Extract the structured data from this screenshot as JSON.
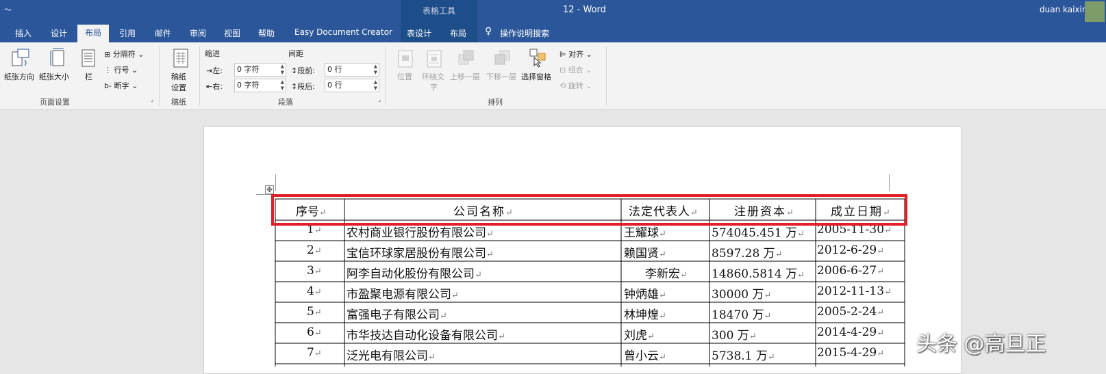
{
  "titlebar": {
    "quick_access": "〜",
    "context_label": "表格工具",
    "doc_title": "12  -  Word",
    "user": "duan kaixin"
  },
  "tabs": [
    "插入",
    "设计",
    "布局",
    "引用",
    "邮件",
    "审阅",
    "视图",
    "帮助",
    "Easy Document Creator",
    "表设计",
    "布局",
    "操作说明搜索"
  ],
  "active_tab": "布局",
  "ribbon": {
    "page_setup": {
      "orientation": "纸张方向",
      "size": "纸张大小",
      "columns": "栏",
      "breaks": "分隔符",
      "line_numbers": "行号",
      "hyphenation": "断字",
      "group": "页面设置"
    },
    "manuscript": {
      "settings_line1": "稿纸",
      "settings_line2": "设置",
      "group": "稿纸"
    },
    "paragraph": {
      "indent": "缩进",
      "spacing": "间距",
      "left_label": "左:",
      "left_value": "0 字符",
      "right_label": "右:",
      "right_value": "0 字符",
      "before_label": "段前:",
      "before_value": "0 行",
      "after_label": "段后:",
      "after_value": "0 行",
      "group": "段落"
    },
    "arrange": {
      "position": "位置",
      "wrap_line1": "环绕文",
      "wrap_line2": "字",
      "bring_forward": "上移一层",
      "send_backward": "下移一层",
      "selection_pane": "选择窗格",
      "align": "对齐",
      "group_btn": "组合",
      "rotate": "旋转",
      "group": "排列"
    }
  },
  "table": {
    "headers": [
      "序号",
      "公司名称",
      "法定代表人",
      "注册资本",
      "成立日期"
    ],
    "rows": [
      [
        "1",
        "农村商业银行股份有限公司",
        "王耀球",
        "574045.451 万",
        "2005-11-30"
      ],
      [
        "2",
        "宝信环球家居股份有限公司",
        "赖国贤",
        "8597.28 万",
        "2012-6-29"
      ],
      [
        "3",
        "阿李自动化股份有限公司",
        "李新宏",
        "14860.5814 万",
        "2006-6-27"
      ],
      [
        "4",
        "市盈聚电源有限公司",
        "钟炳雄",
        "30000 万",
        "2012-11-13"
      ],
      [
        "5",
        "富强电子有限公司",
        "林坤煌",
        "18470 万",
        "2005-2-24"
      ],
      [
        "6",
        "市华技达自动化设备有限公司",
        "刘虎",
        "300 万",
        "2014-4-29"
      ],
      [
        "7",
        "泛光电有限公司",
        "曾小云",
        "5738.1 万",
        "2015-4-29"
      ]
    ],
    "cell_mark": "↵"
  },
  "watermark": "头条 @高旦正",
  "colors": {
    "brand": "#2b579a",
    "highlight": "#e01f26"
  }
}
